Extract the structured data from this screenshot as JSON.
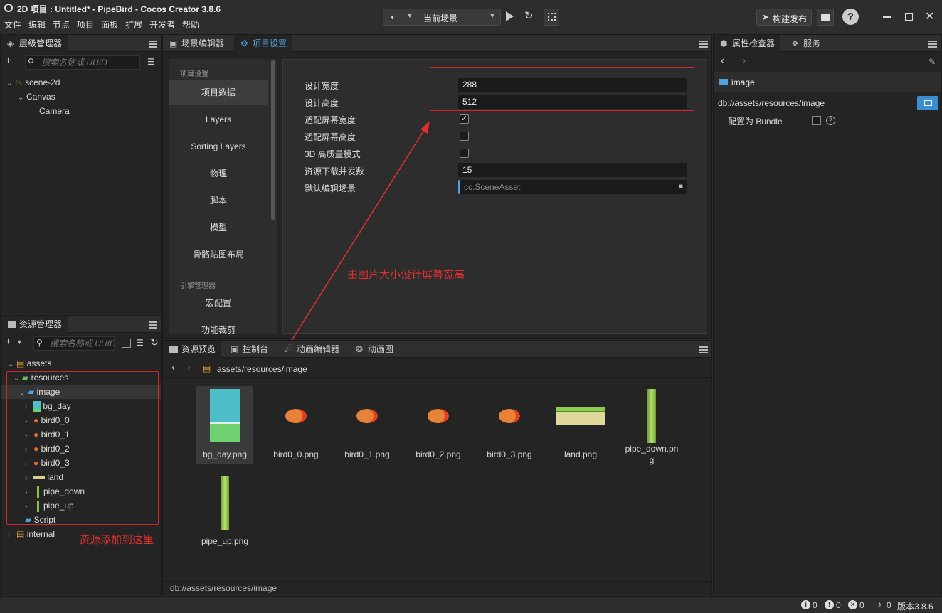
{
  "window": {
    "title": "2D 项目 : Untitled* - PipeBird - Cocos Creator 3.8.6"
  },
  "menu": [
    "文件",
    "编辑",
    "节点",
    "项目",
    "面板",
    "扩展",
    "开发者",
    "帮助"
  ],
  "toolbar": {
    "scene_select": "当前场景",
    "build_publish": "构建发布"
  },
  "hierarchy": {
    "tab": "层级管理器",
    "search_placeholder": "搜索名称或 UUID",
    "nodes": [
      "scene-2d",
      "Canvas",
      "Camera"
    ]
  },
  "center_tabs": [
    "场景编辑器",
    "项目设置"
  ],
  "settings": {
    "group1": "项目设置",
    "side_items": [
      "项目数据",
      "Layers",
      "Sorting Layers",
      "物理",
      "脚本",
      "模型",
      "骨骼贴图布局"
    ],
    "group2": "引擎管理器",
    "side_items2": [
      "宏配置",
      "功能裁剪"
    ],
    "props": {
      "design_width_label": "设计宽度",
      "design_width": "288",
      "design_height_label": "设计高度",
      "design_height": "512",
      "fit_width_label": "适配屏幕宽度",
      "fit_height_label": "适配屏幕高度",
      "hq_label": "3D 高质量模式",
      "concurrency_label": "资源下载并发数",
      "concurrency": "15",
      "default_scene_label": "默认编辑场景",
      "default_scene": "cc.SceneAsset"
    },
    "annotation": "由图片大小设计屏幕宽高"
  },
  "assets": {
    "tab": "资源管理器",
    "search_placeholder": "搜索名称或 UUID",
    "tree": [
      "assets",
      "resources",
      "image",
      "bg_day",
      "bird0_0",
      "bird0_1",
      "bird0_2",
      "bird0_3",
      "land",
      "pipe_down",
      "pipe_up",
      "Script",
      "internal"
    ],
    "annotation": "资源添加到这里"
  },
  "bottom_tabs": [
    "资源预览",
    "控制台",
    "动画编辑器",
    "动画图"
  ],
  "preview": {
    "breadcrumb": [
      "assets",
      "/",
      "resources",
      "/",
      "image"
    ],
    "items": [
      "bg_day.png",
      "bird0_0.png",
      "bird0_1.png",
      "bird0_2.png",
      "bird0_3.png",
      "land.png",
      "pipe_down.png",
      "pipe_up.png"
    ],
    "footer": "db://assets/resources/image"
  },
  "inspector": {
    "tabs": [
      "属性检查器",
      "服务"
    ],
    "name": "image",
    "path": "db://assets/resources/image",
    "bundle_label": "配置为 Bundle"
  },
  "status": {
    "info": "0",
    "warn": "0",
    "error": "0",
    "notice": "0",
    "version": "版本3.8.6"
  },
  "colors": {
    "accent": "#4ea2e0",
    "annotation": "#e03030"
  }
}
